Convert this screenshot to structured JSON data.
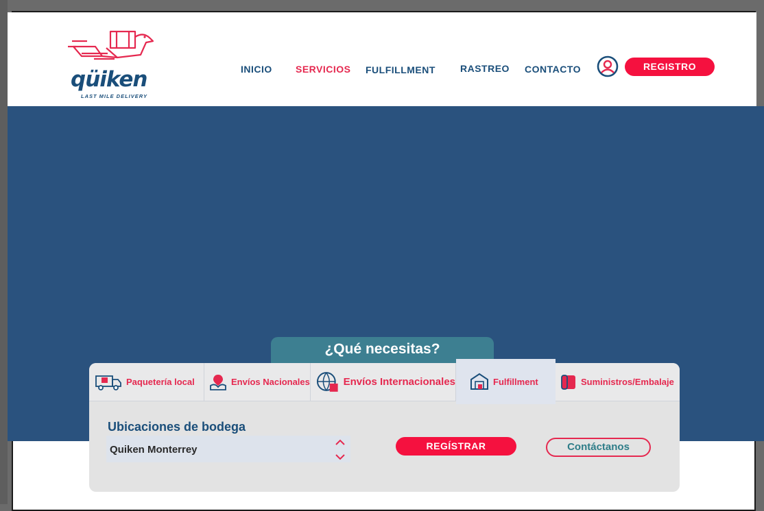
{
  "brand": {
    "name": "qüiken",
    "tagline": "LAST MILE DELIVERY",
    "colors": {
      "navy": "#1a4e7a",
      "red": "#f5113f",
      "teal": "#3d7f91",
      "hero": "#2a527e"
    }
  },
  "nav": {
    "items": [
      {
        "label": "INICIO",
        "active": false
      },
      {
        "label": "SERVICIOS",
        "active": true
      },
      {
        "label": "FULFILLMENT",
        "active": false
      },
      {
        "label": "RASTREO",
        "active": false
      },
      {
        "label": "CONTACTO",
        "active": false
      }
    ],
    "user_icon": "user-circle-icon",
    "register_label": "REGISTRO"
  },
  "services": {
    "heading": "¿Qué necesitas?",
    "tabs": [
      {
        "label": "Paquetería local",
        "icon": "delivery-truck-icon"
      },
      {
        "label": "Envíos Nacionales",
        "icon": "map-pin-hand-icon"
      },
      {
        "label": "Envíos Internacionales",
        "icon": "globe-box-icon"
      },
      {
        "label": "Fulfillment",
        "icon": "warehouse-icon",
        "selected": true
      },
      {
        "label": "Suministros/Embalaje",
        "icon": "packaging-roll-icon"
      }
    ],
    "location_label": "Ubicaciones de bodega",
    "location_value": "Quiken Monterrey",
    "register_button": "REGÍSTRAR",
    "contact_button": "Contáctanos"
  }
}
